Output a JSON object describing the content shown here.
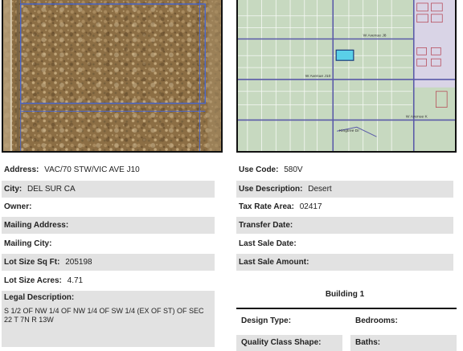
{
  "left": {
    "address": {
      "label": "Address:",
      "value": "VAC/70 STW/VIC AVE J10"
    },
    "city": {
      "label": "City:",
      "value": "DEL SUR CA"
    },
    "owner": {
      "label": "Owner:",
      "value": ""
    },
    "mailing_address": {
      "label": "Mailing Address:",
      "value": ""
    },
    "mailing_city": {
      "label": "Mailing City:",
      "value": ""
    },
    "lot_size_sqft": {
      "label": "Lot Size Sq Ft:",
      "value": "205198"
    },
    "lot_size_acres": {
      "label": "Lot Size Acres:",
      "value": "4.71"
    },
    "legal_description": {
      "label": "Legal Description:",
      "value": "S 1/2 OF NW 1/4 OF NW 1/4 OF SW 1/4 (EX OF ST) OF SEC   22 T 7N R 13W"
    }
  },
  "right": {
    "use_code": {
      "label": "Use Code:",
      "value": "580V"
    },
    "use_description": {
      "label": "Use Description:",
      "value": "Desert"
    },
    "tax_rate_area": {
      "label": "Tax Rate Area:",
      "value": "02417"
    },
    "transfer_date": {
      "label": "Transfer Date:",
      "value": ""
    },
    "last_sale_date": {
      "label": "Last Sale Date:",
      "value": ""
    },
    "last_sale_amount": {
      "label": "Last Sale Amount:",
      "value": ""
    }
  },
  "building": {
    "title": "Building 1",
    "design_type": "Design Type:",
    "bedrooms": "Bedrooms:",
    "quality_class_shape": "Quality Class Shape:",
    "baths": "Baths:"
  },
  "map": {
    "street_labels": [
      "W Avenue J8",
      "W Avenue J10",
      "W Avenue K",
      "Kingtree Dr"
    ],
    "parcel_color": "#5ad0e8",
    "road_color": "#5a5aa8"
  },
  "aerial": {
    "parcel_outline_color": "#4a66c8"
  }
}
